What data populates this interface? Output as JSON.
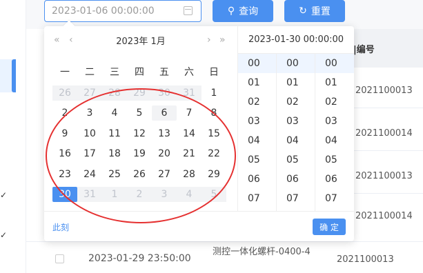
{
  "search": {
    "date_value": "2023-01-06 00:00:00",
    "search_label": "查询",
    "reset_label": "重置"
  },
  "table": {
    "header_partial": "|编号",
    "rows_partial": [
      "2021100013",
      "2021100014",
      "2021100013",
      "2021100014"
    ],
    "bottom_row": {
      "time": "2023-01-29 23:50:00",
      "name": "测控一体化螺杆-0400-4",
      "code": "2021100013"
    }
  },
  "calendar": {
    "prev_year": "«",
    "prev_month": "‹",
    "next_month": "›",
    "next_year": "»",
    "title": "2023年  1月",
    "weekdays": [
      "一",
      "二",
      "三",
      "四",
      "五",
      "六",
      "日"
    ],
    "weeks": [
      [
        "26",
        "27",
        "28",
        "29",
        "30",
        "31",
        "1"
      ],
      [
        "2",
        "3",
        "4",
        "5",
        "6",
        "7",
        "8"
      ],
      [
        "9",
        "10",
        "11",
        "12",
        "13",
        "14",
        "15"
      ],
      [
        "16",
        "17",
        "18",
        "19",
        "20",
        "21",
        "22"
      ],
      [
        "23",
        "24",
        "25",
        "26",
        "27",
        "28",
        "29"
      ],
      [
        "30",
        "31",
        "1",
        "2",
        "3",
        "4",
        "5"
      ]
    ],
    "selected_day": "6",
    "current_day": "30"
  },
  "time_panel": {
    "header": "2023-01-30 00:00:00",
    "hours": [
      "00",
      "01",
      "02",
      "03",
      "04",
      "05",
      "06",
      "07"
    ],
    "minutes": [
      "00",
      "01",
      "02",
      "03",
      "04",
      "05",
      "06",
      "07"
    ],
    "seconds": [
      "00",
      "01",
      "02",
      "03",
      "04",
      "05",
      "06",
      "07"
    ]
  },
  "footer": {
    "now_label": "此刻",
    "confirm_label": "确 定"
  },
  "colors": {
    "accent": "#4a90f0",
    "annotation": "#e53030"
  }
}
